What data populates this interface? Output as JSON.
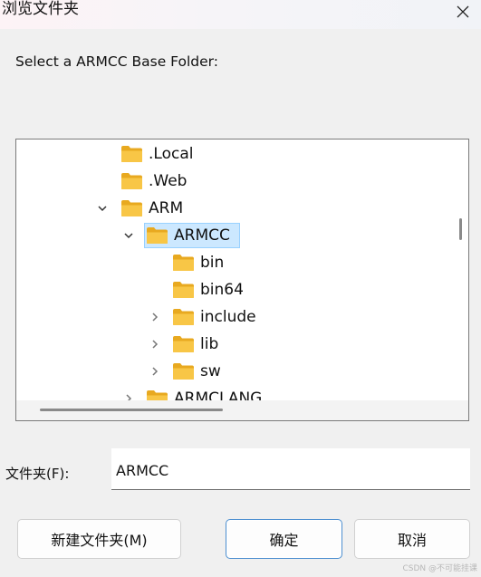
{
  "window": {
    "title": "浏览文件夹",
    "close_icon": "close-icon"
  },
  "prompt": "Select a ARMCC Base Folder:",
  "tree": {
    "items": [
      {
        "label": ".Local",
        "expander": "none"
      },
      {
        "label": ".Web",
        "expander": "none"
      },
      {
        "label": "ARM",
        "expander": "expanded"
      },
      {
        "label": "ARMCC",
        "expander": "expanded",
        "selected": true
      },
      {
        "label": "bin",
        "expander": "none"
      },
      {
        "label": "bin64",
        "expander": "none"
      },
      {
        "label": "include",
        "expander": "collapsed"
      },
      {
        "label": "lib",
        "expander": "collapsed"
      },
      {
        "label": "sw",
        "expander": "collapsed"
      },
      {
        "label": "ARMCLANG",
        "expander": "collapsed"
      }
    ]
  },
  "folder_field": {
    "label": "文件夹(F):",
    "value": "ARMCC"
  },
  "buttons": {
    "new_folder": "新建文件夹(M)",
    "ok": "确定",
    "cancel": "取消"
  },
  "watermark": "CSDN @不可能挂课",
  "colors": {
    "selection_fill": "#cce8ff",
    "selection_border": "#99d1ff",
    "primary_border": "#4c8fd0",
    "folder_yellow": "#f8c646"
  }
}
